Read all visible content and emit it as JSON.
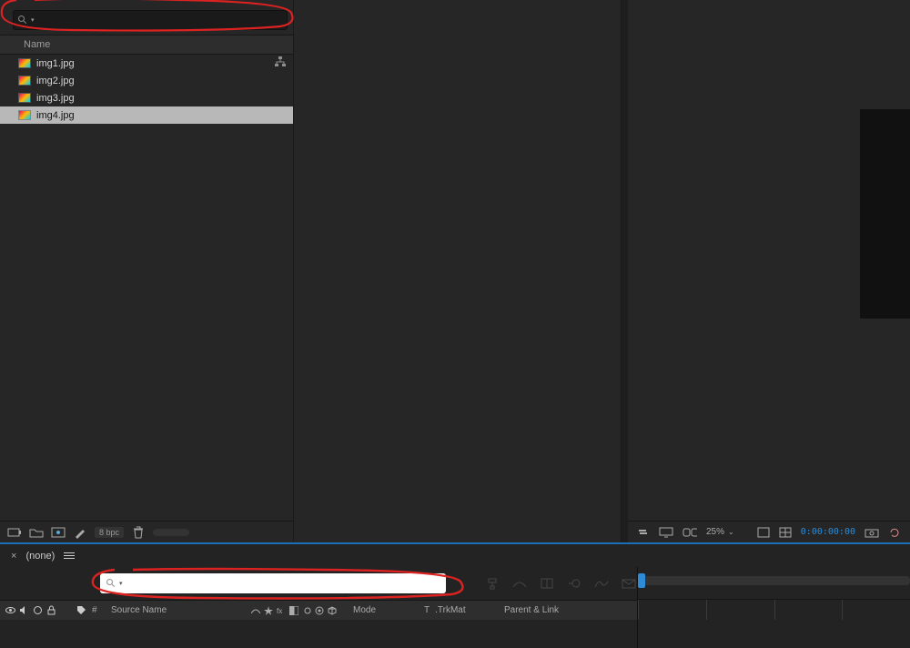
{
  "project": {
    "search_placeholder": "",
    "column": "Name",
    "files": [
      {
        "name": "img1.jpg"
      },
      {
        "name": "img2.jpg"
      },
      {
        "name": "img3.jpg"
      },
      {
        "name": "img4.jpg"
      }
    ],
    "selected_index": 3,
    "bpc": "8 bpc"
  },
  "viewer": {
    "zoom": "25%",
    "timecode": "0:00:00:00"
  },
  "timeline": {
    "tab_label": "(none)",
    "search_placeholder": "",
    "cols": {
      "hash": "#",
      "source": "Source Name",
      "mode": "Mode",
      "t": "T",
      "trkmat": ".TrkMat",
      "parent": "Parent & Link"
    }
  }
}
